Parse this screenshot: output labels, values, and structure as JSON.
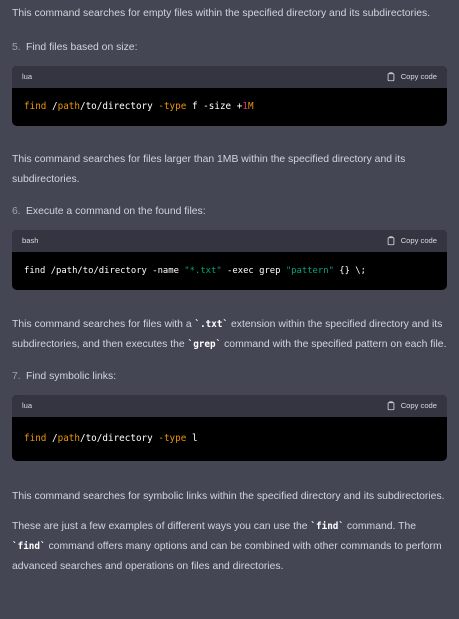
{
  "intro": "This command searches for empty files within the specified directory and its subdirectories.",
  "item5": {
    "num": "5.",
    "text": "Find files based on size:"
  },
  "code1": {
    "lang": "lua",
    "copy": "Copy code",
    "parts": [
      "find",
      " /",
      "path",
      "/to/directory ",
      "-type",
      " f -size +",
      "1",
      "M"
    ]
  },
  "desc1": "This command searches for files larger than 1MB within the specified directory and its subdirectories.",
  "item6": {
    "num": "6.",
    "text": "Execute a command on the found files:"
  },
  "code2": {
    "lang": "bash",
    "copy": "Copy code",
    "parts": [
      "find /path/to/directory -name ",
      "\"*.txt\"",
      " -exec grep ",
      "\"pattern\"",
      " {} \\;"
    ]
  },
  "desc2": {
    "a": "This command searches for files with a ",
    "b": "`.txt`",
    "c": " extension within the specified directory and its subdirectories, and then executes the ",
    "d": "`grep`",
    "e": " command with the specified pattern on each file."
  },
  "item7": {
    "num": "7.",
    "text": "Find symbolic links:"
  },
  "code3": {
    "lang": "lua",
    "copy": "Copy code",
    "parts": [
      "find",
      " /",
      "path",
      "/to/directory ",
      "-type",
      " l"
    ]
  },
  "desc3": "This command searches for symbolic links within the specified directory and its subdirectories.",
  "outro": {
    "a": "These are just a few examples of different ways you can use the ",
    "b": "`find`",
    "c": " command. The ",
    "d": "`find`",
    "e": " command offers many options and can be combined with other commands to perform advanced searches and operations on files and directories."
  }
}
